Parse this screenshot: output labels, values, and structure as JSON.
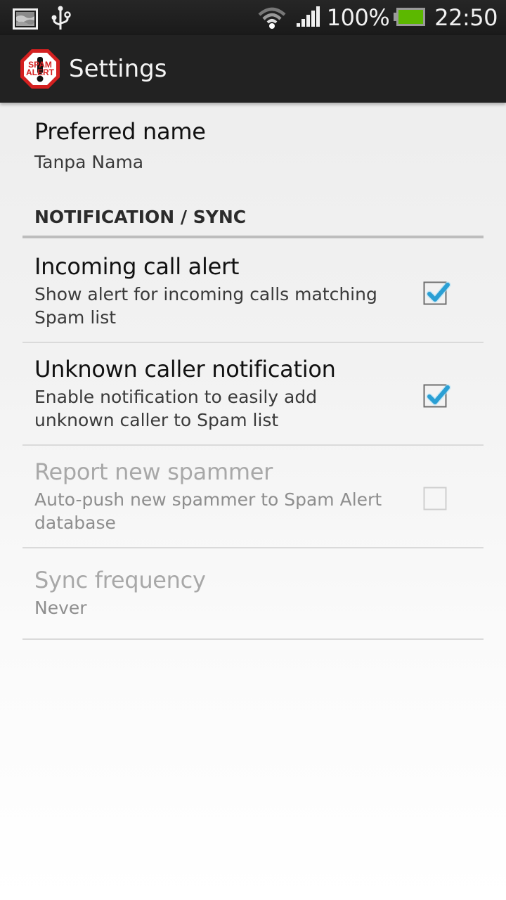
{
  "status_bar": {
    "icons_left": [
      "image-notification-icon",
      "usb-icon"
    ],
    "icons_right": [
      "wifi-icon",
      "signal-icon",
      "battery-icon"
    ],
    "battery_percent": "100%",
    "time": "22:50",
    "battery_color": "#5cb800"
  },
  "action_bar": {
    "logo_text_line1": "SPAM",
    "logo_text_line2": "ALERT",
    "title": "Settings"
  },
  "preferences": {
    "preferred_name": {
      "title": "Preferred name",
      "summary": "Tanpa Nama"
    },
    "category": {
      "title": "NOTIFICATION / SYNC"
    },
    "items": [
      {
        "title": "Incoming call alert",
        "summary": "Show alert for incoming calls matching Spam list",
        "checked": true,
        "enabled": true
      },
      {
        "title": "Unknown caller notification",
        "summary": "Enable notification to easily add unknown caller to Spam list",
        "checked": true,
        "enabled": true
      },
      {
        "title": "Report new spammer",
        "summary": "Auto-push new spammer to Spam Alert database",
        "checked": false,
        "enabled": false
      }
    ],
    "sync_frequency": {
      "title": "Sync frequency",
      "summary": "Never",
      "enabled": false
    }
  },
  "colors": {
    "check_accent": "#33b5e5",
    "action_bar_bg": "#222222",
    "logo_red": "#d42020"
  }
}
